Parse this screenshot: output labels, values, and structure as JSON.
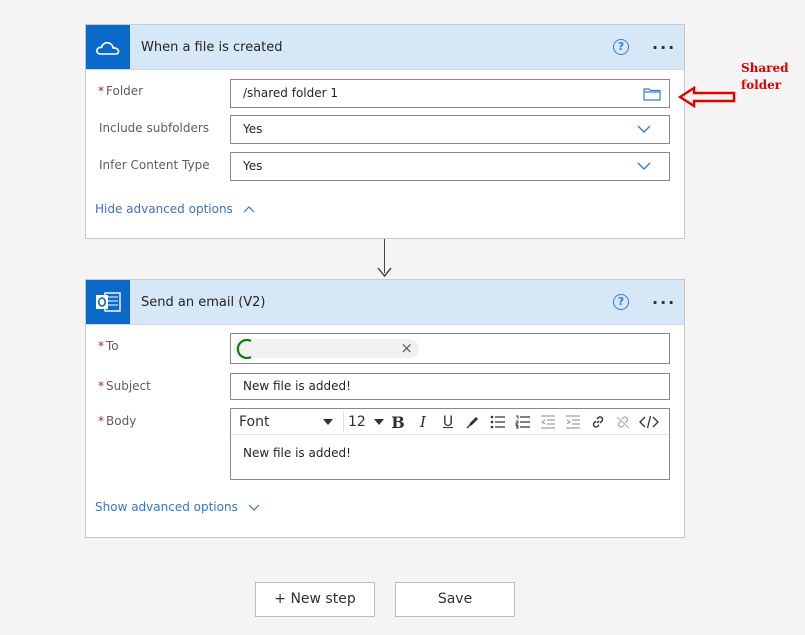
{
  "trigger": {
    "title": "When a file is created",
    "help_glyph": "?",
    "more_glyph": "···",
    "icon": "onedrive-cloud-icon",
    "fields": [
      {
        "label": "Folder",
        "required": true,
        "value": "/shared folder 1",
        "control": "folder-picker"
      },
      {
        "label": "Include subfolders",
        "required": false,
        "value": "Yes",
        "control": "dropdown"
      },
      {
        "label": "Infer Content Type",
        "required": false,
        "value": "Yes",
        "control": "dropdown"
      }
    ],
    "advanced_link": "Hide advanced options"
  },
  "action": {
    "title": "Send an email (V2)",
    "help_glyph": "?",
    "more_glyph": "···",
    "icon": "outlook-icon",
    "to_label": "To",
    "to_token_remove": "×",
    "subject_label": "Subject",
    "subject_value": "New file is added!",
    "body_label": "Body",
    "body_value": "New file is added!",
    "toolbar": {
      "font_label": "Font",
      "size_label": "12",
      "bold": "B",
      "italic": "I",
      "underline": "U"
    },
    "advanced_link": "Show advanced options"
  },
  "required_marker": "*",
  "buttons": {
    "new_step": "+ New step",
    "save": "Save"
  },
  "annotation": {
    "line1": "Shared",
    "line2": "folder",
    "color": "#e00000"
  }
}
